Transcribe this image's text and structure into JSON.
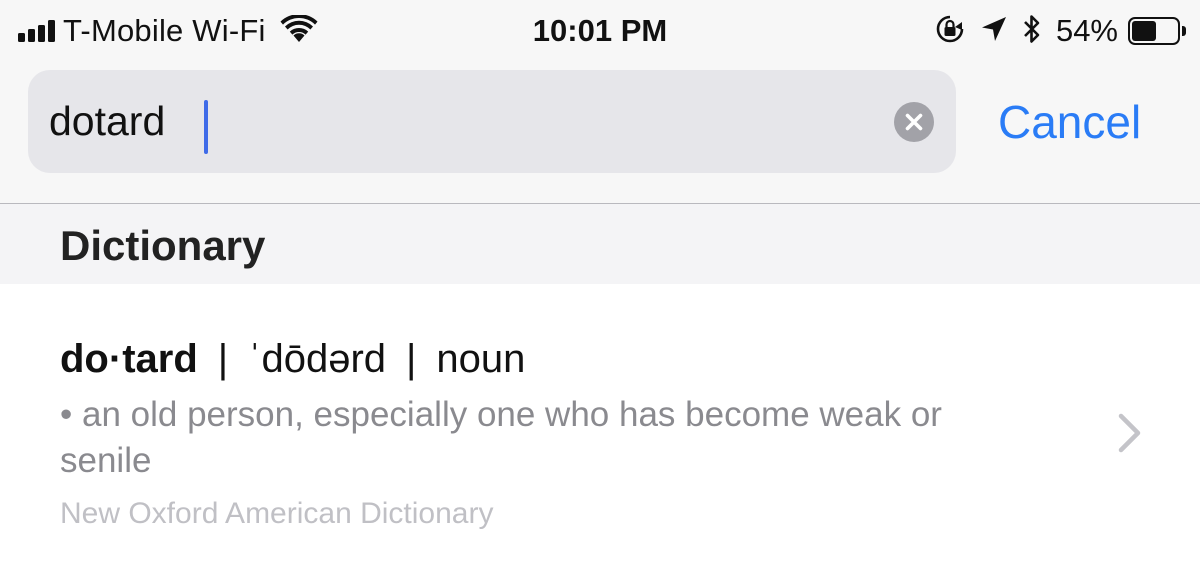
{
  "status_bar": {
    "carrier": "T-Mobile Wi-Fi",
    "time": "10:01 PM",
    "battery_percent_label": "54%",
    "battery_level": 0.54,
    "icons": [
      "signal-icon",
      "wifi-icon",
      "rotation-lock-icon",
      "location-icon",
      "bluetooth-icon",
      "battery-icon"
    ]
  },
  "search": {
    "query": "dotard",
    "cancel_label": "Cancel",
    "clear_icon": "clear-circle-icon"
  },
  "section": {
    "title": "Dictionary"
  },
  "result": {
    "headword": "do·tard",
    "separator": "|",
    "pronunciation": "ˈdōdərd",
    "part_of_speech": "noun",
    "definition": "• an old person, especially one who has become weak or senile",
    "source": "New Oxford American Dictionary",
    "chevron_icon": "chevron-right-icon"
  },
  "colors": {
    "accent": "#2a7cf6",
    "caret": "#3f6be8",
    "header_bg": "#f7f7f7",
    "field_bg": "#e6e6ea",
    "definition_text": "#8a8a8f",
    "source_text": "#c0c0c5"
  }
}
